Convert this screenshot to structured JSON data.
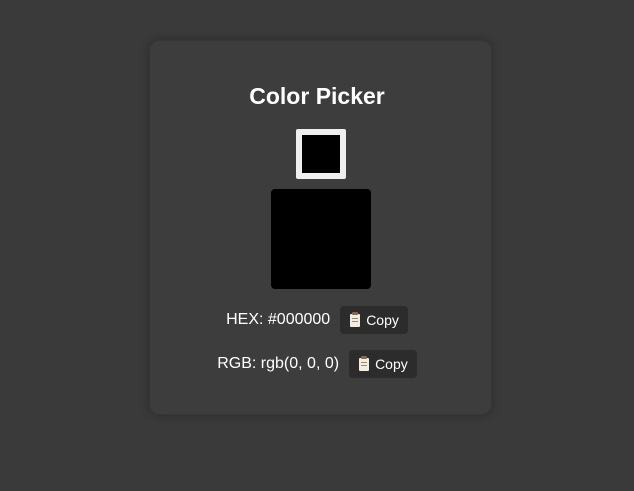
{
  "app": {
    "title": "Color Picker"
  },
  "picker": {
    "value": "#000000"
  },
  "hex": {
    "label": "HEX: #000000",
    "copy_label": "Copy"
  },
  "rgb": {
    "label": "RGB: rgb(0, 0, 0)",
    "copy_label": "Copy"
  },
  "colors": {
    "background": "#3a3a3a",
    "card": "#3d3d3d",
    "selected": "#000000",
    "button": "#2c2c2c"
  },
  "icons": {
    "copy": "clipboard-icon"
  }
}
